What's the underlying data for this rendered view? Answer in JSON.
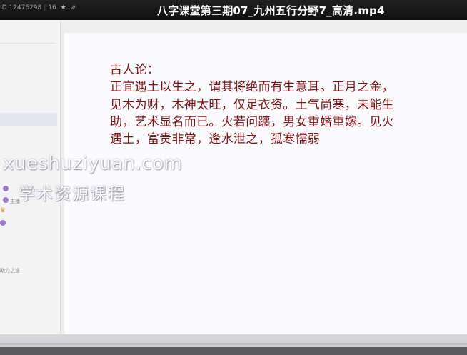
{
  "titlebar": {
    "room_id": "ID 12476298",
    "count": "16",
    "star_icon": "star-icon",
    "share_icon": "share-icon",
    "video_title": "八字课堂第三期07_九州五行分野7_高清.mp4"
  },
  "left_panel": {
    "chat_texts": [
      "主播",
      "助力之道"
    ]
  },
  "slide": {
    "heading": "古人论：",
    "lines": [
      "正宜遇土以生之，谓其将绝而有生意耳。正月之金，",
      "见木为财，木神太旺，仅足衣资。土气尚寒，未能生",
      "助，艺术显名而已。火若问躔，男女重婚重嫁。见火",
      "遇土，富贵非常，逢水泄之，孤寒懦弱"
    ]
  },
  "watermark": {
    "en": "xueshuziyuan.com",
    "cn": "学术资源课程"
  },
  "player": {
    "progress": 0.0
  },
  "colors": {
    "slide_text": "#7a1416",
    "titlebar_bg": "#1a1a1a",
    "chat_dot": "#9b7ad1"
  }
}
